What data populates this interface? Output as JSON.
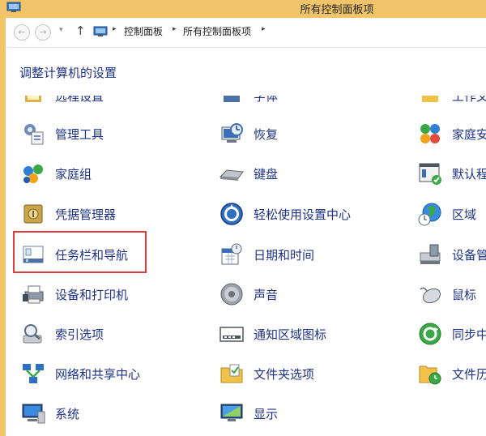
{
  "window": {
    "title": "所有控制面板项"
  },
  "addressbar": {
    "back_glyph": "←",
    "forward_glyph": "→",
    "up_glyph": "↑",
    "separator": "▸",
    "breadcrumbs": [
      "控制面板",
      "所有控制面板项"
    ]
  },
  "main": {
    "heading": "调整计算机的设置"
  },
  "items": {
    "col1": [
      "远程设置",
      "管理工具",
      "家庭组",
      "凭据管理器",
      "任务栏和导航",
      "设备和打印机",
      "索引选项",
      "网络和共享中心",
      "系统"
    ],
    "col2": [
      "字体",
      "恢复",
      "键盘",
      "轻松使用设置中心",
      "日期和时间",
      "声音",
      "通知区域图标",
      "文件夹选项",
      "显示"
    ],
    "col3": [
      "工作文",
      "家庭安",
      "默认程",
      "区域",
      "设备管",
      "鼠标",
      "同步中",
      "文件历"
    ]
  },
  "highlight": {
    "target": "任务栏和导航",
    "color": "#e03c3c"
  },
  "colors": {
    "titlebar": "#f1c469",
    "link": "#1e3287"
  }
}
